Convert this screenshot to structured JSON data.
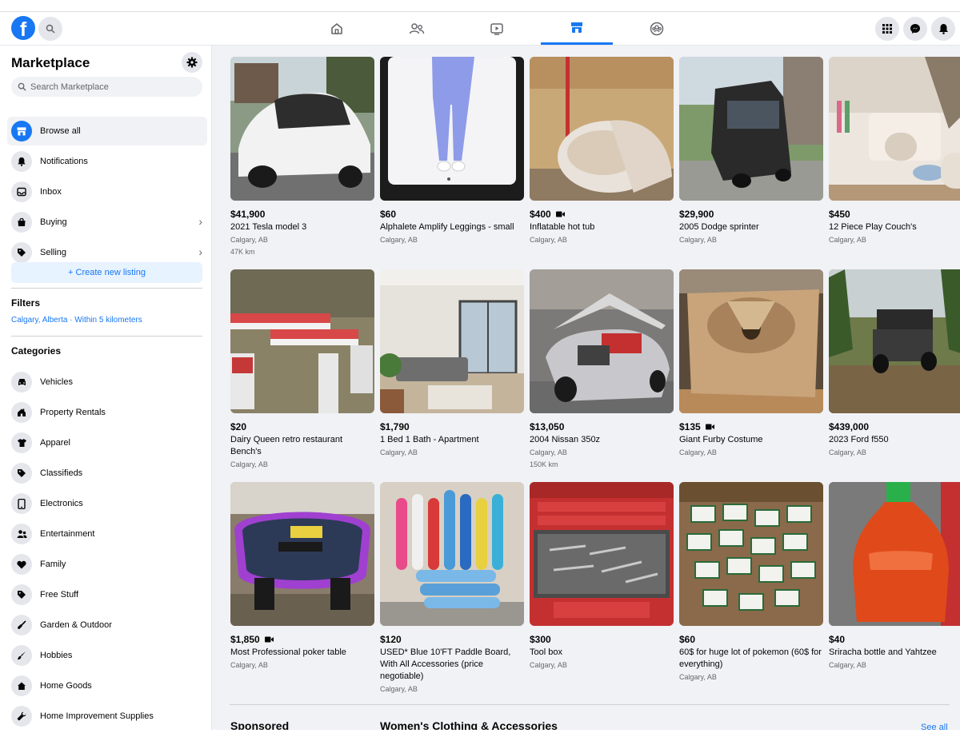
{
  "topbar": {
    "logo_letter": "f",
    "tabs": [
      "home-icon",
      "friends-icon",
      "watch-icon",
      "marketplace-icon",
      "groups-icon"
    ],
    "right_buttons": [
      "menu-grid-icon",
      "messenger-icon",
      "notifications-bell-icon"
    ]
  },
  "sidebar": {
    "title": "Marketplace",
    "search_placeholder": "Search Marketplace",
    "menu": [
      {
        "label": "Browse all",
        "icon": "storefront-icon"
      },
      {
        "label": "Notifications",
        "icon": "bell-icon"
      },
      {
        "label": "Inbox",
        "icon": "inbox-icon"
      },
      {
        "label": "Buying",
        "icon": "bag-icon"
      },
      {
        "label": "Selling",
        "icon": "tag-icon"
      }
    ],
    "create_label": "+ Create new listing",
    "filters_title": "Filters",
    "filter_location": "Calgary, Alberta · Within 5 kilometers",
    "categories_title": "Categories",
    "categories": [
      {
        "label": "Vehicles",
        "icon": "car-icon"
      },
      {
        "label": "Property Rentals",
        "icon": "house-icon"
      },
      {
        "label": "Apparel",
        "icon": "shirt-icon"
      },
      {
        "label": "Classifieds",
        "icon": "tag-icon"
      },
      {
        "label": "Electronics",
        "icon": "phone-icon"
      },
      {
        "label": "Entertainment",
        "icon": "people-icon"
      },
      {
        "label": "Family",
        "icon": "heart-icon"
      },
      {
        "label": "Free Stuff",
        "icon": "tag-icon"
      },
      {
        "label": "Garden & Outdoor",
        "icon": "shovel-icon"
      },
      {
        "label": "Hobbies",
        "icon": "brush-icon"
      },
      {
        "label": "Home Goods",
        "icon": "home-icon"
      },
      {
        "label": "Home Improvement Supplies",
        "icon": "wrench-icon"
      }
    ]
  },
  "listings": [
    {
      "price": "$41,900",
      "title": "2021 Tesla model 3",
      "location": "Calgary, AB",
      "extra": "47K km",
      "video": false
    },
    {
      "price": "$60",
      "title": "Alphalete Amplify Leggings - small",
      "location": "Calgary, AB",
      "extra": "",
      "video": false
    },
    {
      "price": "$400",
      "title": "Inflatable hot tub",
      "location": "Calgary, AB",
      "extra": "",
      "video": true
    },
    {
      "price": "$29,900",
      "title": "2005 Dodge sprinter",
      "location": "Calgary, AB",
      "extra": "",
      "video": false
    },
    {
      "price": "$450",
      "title": "12 Piece Play Couch's",
      "location": "Calgary, AB",
      "extra": "",
      "video": false
    },
    {
      "price": "$20",
      "title": "Dairy Queen retro restaurant Bench's",
      "location": "Calgary, AB",
      "extra": "",
      "video": false
    },
    {
      "price": "$1,790",
      "title": "1 Bed 1 Bath - Apartment",
      "location": "Calgary, AB",
      "extra": "",
      "video": false
    },
    {
      "price": "$13,050",
      "title": "2004 Nissan 350z",
      "location": "Calgary, AB",
      "extra": "150K km",
      "video": false
    },
    {
      "price": "$135",
      "title": "Giant Furby Costume",
      "location": "Calgary, AB",
      "extra": "",
      "video": true
    },
    {
      "price": "$439,000",
      "title": "2023 Ford f550",
      "location": "Calgary, AB",
      "extra": "",
      "video": false
    },
    {
      "price": "$1,850",
      "title": "Most Professional poker table",
      "location": "Calgary, AB",
      "extra": "",
      "video": true
    },
    {
      "price": "$120",
      "title": "USED* Blue 10'FT Paddle Board, With All Accessories (price negotiable)",
      "location": "Calgary, AB",
      "extra": "",
      "video": false
    },
    {
      "price": "$300",
      "title": "Tool box",
      "location": "Calgary, AB",
      "extra": "",
      "video": false
    },
    {
      "price": "$60",
      "title": "60$ for huge lot of pokemon (60$ for everything)",
      "location": "Calgary, AB",
      "extra": "",
      "video": false
    },
    {
      "price": "$40",
      "title": "Sriracha bottle and Yahtzee",
      "location": "Calgary, AB",
      "extra": "",
      "video": false
    }
  ],
  "footer": {
    "sponsored": "Sponsored",
    "section_title": "Women's Clothing & Accessories",
    "see_all": "See all"
  },
  "colors": {
    "accent": "#1877f2",
    "background": "#f0f2f5"
  }
}
